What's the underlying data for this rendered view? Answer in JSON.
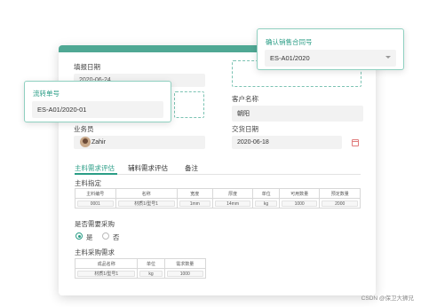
{
  "form": {
    "fill_date_label": "填报日期",
    "fill_date_value": "2020-06-24",
    "customer_label": "客户名称",
    "customer_value": "朝阳",
    "salesperson_label": "业务员",
    "salesperson_value": "Zahir",
    "delivery_label": "交货日期",
    "delivery_value": "2020-06-18"
  },
  "popover_flow": {
    "title": "流转单号",
    "value": "ES-A01/2020-01"
  },
  "popover_contract": {
    "title": "确认销售合同号",
    "value": "ES-A01/2020"
  },
  "tabs": [
    "主料需求评估",
    "辅料需求评估",
    "备注"
  ],
  "main_material": {
    "section_label": "主料指定",
    "headers": [
      "主料编号",
      "名称",
      "宽度",
      "厚度",
      "单位",
      "可用数量",
      "预定数量"
    ],
    "row": [
      "0001",
      "材质1/型号1",
      "1mm",
      "14mm",
      "kg",
      "1000",
      "2000"
    ]
  },
  "purchase": {
    "question": "是否需要采购",
    "yes": "是",
    "no": "否"
  },
  "purchase_requirement": {
    "section_label": "主料采购需求",
    "headers": [
      "成品名称",
      "单位",
      "需求数量"
    ],
    "row": [
      "材质1/型号1",
      "kg",
      "1000"
    ]
  },
  "watermark": "CSDN @保卫大狮兄",
  "colors": {
    "accent": "#2a9d86",
    "topbar": "#4fa894"
  }
}
